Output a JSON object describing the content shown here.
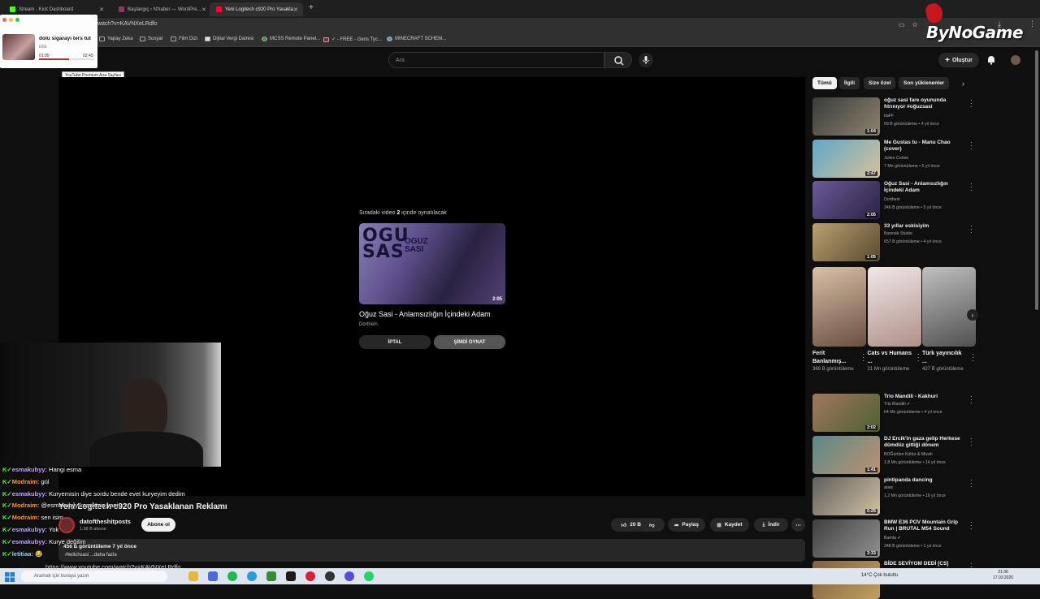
{
  "browser": {
    "tabs": [
      {
        "label": "Stream - Kick Dashboard",
        "color": "#53fc18"
      },
      {
        "label": "Başlangıç ‹ N'haber — WordPre...",
        "color": "#8b3a62"
      },
      {
        "label": "Yeni Logitech c920 Pro Yasakla...",
        "color": "#ff0033"
      }
    ],
    "url": "watch?v=KAVNXeLRdfo",
    "bookmarks": [
      "Yapay Zeka",
      "Sosyal",
      "Film Dizi",
      "Dijital Vergi Dairesi",
      "MCSS Remote Panel...",
      "✓ - FREE - Gens Tyc...",
      "MINECRAFT SCHEM..."
    ]
  },
  "overlay": {
    "logo": "ByNoGame",
    "miniplayer": {
      "title": "dolu sigarayı ters tut",
      "sub": "ЕБЕ",
      "elapsed": "01:05",
      "total": "02:45",
      "progress": 0.55
    },
    "tooltip": "YouTube Premium Ana Sayfası"
  },
  "yt_header": {
    "search_placeholder": "Ara",
    "create_label": "Oluştur"
  },
  "player": {
    "next_label_pre": "Sıradaki video ",
    "next_seconds": "2",
    "next_label_post": " içinde oynatılacak",
    "next_thumb_text1": "OGU\nSAS",
    "next_thumb_text2": "OGUZ\nSASI",
    "next_duration": "2:05",
    "next_title": "Oğuz Sasi - Anlamsızlığın İçindeki Adam",
    "next_channel": "Dorthein",
    "cancel_label": "İPTAL",
    "play_now_label": "ŞİMDİ OYNAT"
  },
  "chat": [
    {
      "user": "esmakubyy:",
      "msg": " Hangi esma",
      "color": "#c9a6ff"
    },
    {
      "user": "Modraim:",
      "msg": " gül",
      "color": "#ff9a3c"
    },
    {
      "user": "esmakubyy:",
      "msg": " Kuryemisin diye sordu bende evet kuryeyim dedim",
      "color": "#c9a6ff"
    },
    {
      "user": "Modraim:",
      "msg": " @esmakubyy komikmiş yani",
      "color": "#ff9a3c"
    },
    {
      "user": "Modraim:",
      "msg": " sen isim",
      "color": "#ff9a3c"
    },
    {
      "user": "esmakubyy:",
      "msg": " Yok",
      "color": "#c9a6ff"
    },
    {
      "user": "esmakubyy:",
      "msg": " Kurye değilim",
      "color": "#c9a6ff"
    },
    {
      "user": "letitiaa:",
      "msg": " 😂",
      "color": "#9ad0ff"
    }
  ],
  "video": {
    "title": "Yeni Logitech c920 Pro Yasaklanan Reklamı",
    "channel": "datoftheshitposts",
    "subscribers": "1,68 B abone",
    "subscribe_label": "Abone ol",
    "likes": "20 B",
    "share_label": "Paylaş",
    "save_label": "Kaydet",
    "download_label": "İndir",
    "views_date": "456 B görüntüleme  7 yıl önce",
    "tags": "#twitchsasi  ...daha fazla",
    "desc_url": "https://www.youtube.com/watch?v=KAVNXeLRdfo"
  },
  "sidebar": {
    "chips": [
      "Tümü",
      "İlgili",
      "Size özel",
      "Son yüklenenler"
    ],
    "videos_top": [
      {
        "title": "oğuz sasi fare oyununda fıtrınıyor  #oğuzsasi",
        "channel": "baFF",
        "meta": "69 B görüntüleme • 4 yıl önce",
        "duration": "1:04",
        "colors": [
          "#3a3a3a",
          "#8c8470"
        ]
      },
      {
        "title": "Me Gustas tu - Manu Chao (cover)",
        "channel": "Julien Cohen",
        "meta": "7 Mn görüntüleme • 5 yıl önce",
        "duration": "2:47",
        "colors": [
          "#5fa8c8",
          "#d8c09a"
        ]
      },
      {
        "title": "Oğuz Sasi - Anlamsızlığın İçindeki Adam",
        "channel": "Dorthein",
        "meta": "246 B görüntüleme • 5 yıl önce",
        "duration": "2:05",
        "colors": [
          "#6a5a9a",
          "#2a2240"
        ]
      },
      {
        "title": "33 yıllar eskisiyim",
        "channel": "Bizenek Studio",
        "meta": "657 B görüntüleme • 4 yıl önce",
        "duration": "1:05",
        "colors": [
          "#b8a070",
          "#5a4a30"
        ]
      }
    ],
    "shorts": [
      {
        "title": "Ferit Banlanmış...",
        "views": "369 B görüntüleme",
        "colors": [
          "#d8c0a8",
          "#6a5040"
        ]
      },
      {
        "title": "Cats vs Humans ...",
        "views": "21 Mn görüntüleme",
        "colors": [
          "#f0e8e8",
          "#b09088"
        ]
      },
      {
        "title": "Türk yayıncılık ...",
        "views": "427 B görüntüleme",
        "colors": [
          "#c0c0c0",
          "#505050"
        ]
      }
    ],
    "videos_bottom": [
      {
        "title": "Trio Mandili - Kakhuri",
        "channel": "Trio Mandili ✔",
        "meta": "64 Mn görüntüleme • 4 yıl önce",
        "duration": "2:02",
        "colors": [
          "#a07860",
          "#506030"
        ]
      },
      {
        "title": "DJ Ercik'in gaza gelip Herkese dümdüz gittiği dönem",
        "channel": "BOĞürtlen Kültür & Mizah",
        "meta": "1,8 Mn görüntüleme • 14 yıl önce",
        "duration": "1:41",
        "colors": [
          "#5a8a8a",
          "#c09070"
        ]
      },
      {
        "title": "pintipanda dancing",
        "channel": "ataw",
        "meta": "1,2 Mn görüntüleme • 16 yıl önce",
        "duration": "0:25",
        "colors": [
          "#606060",
          "#d0c0a0"
        ]
      },
      {
        "title": "BMW E36 POV Mountain Grip Run | BRUTAL M54 Sound",
        "channel": "Bamfa ✔",
        "meta": "348 B görüntüleme • 1 yıl önce",
        "duration": "3:33",
        "colors": [
          "#404040",
          "#909090"
        ]
      },
      {
        "title": "BİDE SEVİYOM DEDİ [CS]",
        "channel": "",
        "meta": "",
        "duration": "",
        "colors": [
          "#806040",
          "#c0a060"
        ]
      }
    ]
  },
  "taskbar": {
    "search_placeholder": "Aramak için buraya yazın",
    "weather": "14°C  Çok bulutlu",
    "time": "21:36",
    "date": "17.03.2026"
  }
}
